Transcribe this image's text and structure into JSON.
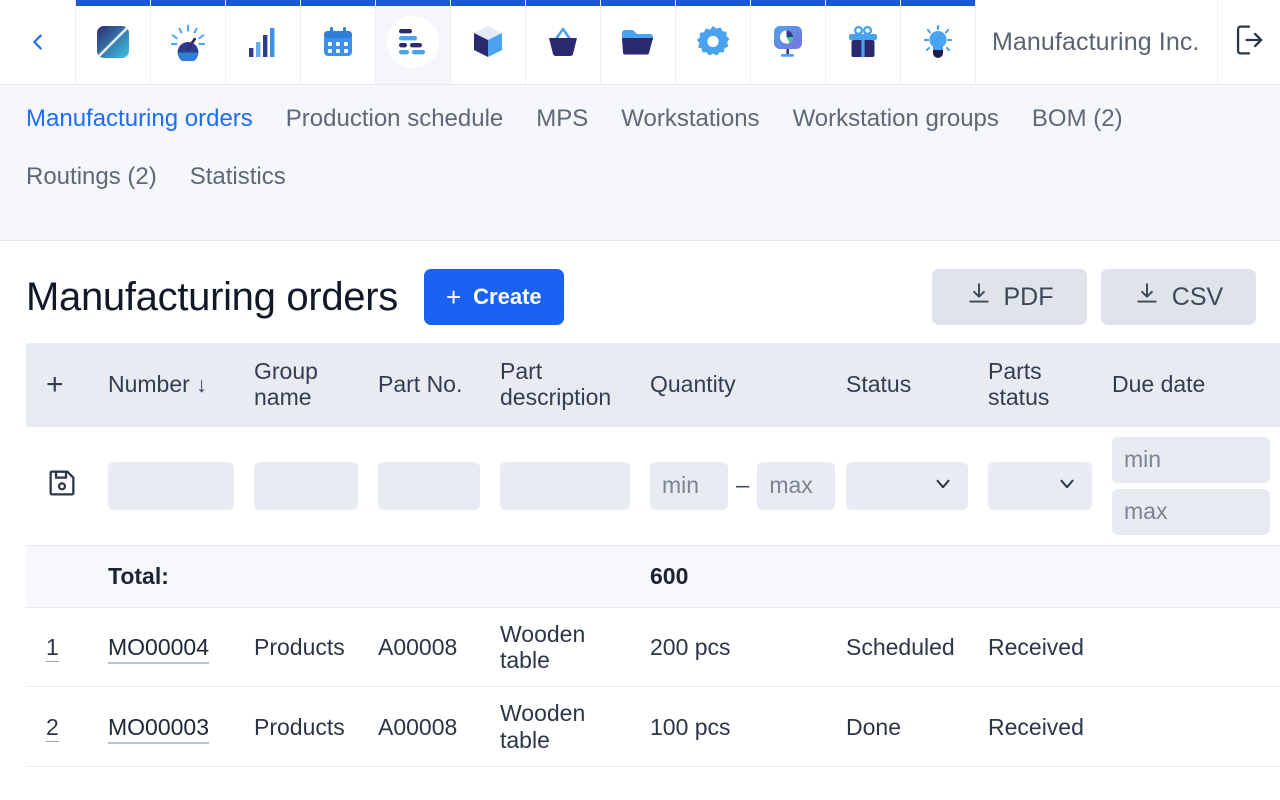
{
  "appbar": {
    "back_icon": "chevron-left-icon",
    "company": "Manufacturing Inc.",
    "logout_icon": "logout-icon",
    "apps": [
      {
        "name": "dashboard-tile-icon",
        "label": "Dashboard"
      },
      {
        "name": "gauge-icon",
        "label": "Overview"
      },
      {
        "name": "bar-chart-icon",
        "label": "Reports"
      },
      {
        "name": "calendar-icon",
        "label": "Calendar"
      },
      {
        "name": "manufacturing-list-icon",
        "label": "Manufacturing",
        "active": true
      },
      {
        "name": "cube-box-icon",
        "label": "Stock"
      },
      {
        "name": "basket-icon",
        "label": "Sales"
      },
      {
        "name": "folder-open-icon",
        "label": "Procurement"
      },
      {
        "name": "gear-icon",
        "label": "Settings"
      },
      {
        "name": "pie-presentation-icon",
        "label": "Analytics"
      },
      {
        "name": "gift-icon",
        "label": "Offers"
      },
      {
        "name": "lightbulb-icon",
        "label": "Tips"
      }
    ]
  },
  "nav": {
    "rows": [
      [
        {
          "label": "Manufacturing orders",
          "active": true
        },
        {
          "label": "Production schedule",
          "active": false
        },
        {
          "label": "MPS",
          "active": false
        },
        {
          "label": "Workstations",
          "active": false
        },
        {
          "label": "Workstation groups",
          "active": false
        },
        {
          "label": "BOM (2)",
          "active": false
        }
      ],
      [
        {
          "label": "Routings (2)",
          "active": false
        },
        {
          "label": "Statistics",
          "active": false
        }
      ]
    ]
  },
  "page": {
    "title": "Manufacturing orders",
    "create_label": "Create",
    "create_plus": "+",
    "pdf_label": "PDF",
    "csv_label": "CSV"
  },
  "table": {
    "add_column_glyph": "+",
    "sort_arrow": "↓",
    "headers": {
      "number": "Number",
      "group_name": "Group name",
      "part_no": "Part No.",
      "part_description": "Part description",
      "quantity": "Quantity",
      "status": "Status",
      "parts_status": "Parts status",
      "due_date": "Due date"
    },
    "filters": {
      "number": "",
      "group_name": "",
      "part_no": "",
      "part_description": "",
      "qty_min_placeholder": "min",
      "qty_max_placeholder": "max",
      "range_dash": "–",
      "status": "",
      "parts_status": "",
      "due_min_placeholder": "min",
      "due_max_placeholder": "max"
    },
    "total": {
      "label": "Total:",
      "quantity": "600"
    },
    "rows": [
      {
        "index": "1",
        "number": "MO00004",
        "group_name": "Products",
        "part_no": "A00008",
        "part_description": "Wooden table",
        "quantity": "200 pcs",
        "status": "Scheduled",
        "parts_status": "Received",
        "due_date": ""
      },
      {
        "index": "2",
        "number": "MO00003",
        "group_name": "Products",
        "part_no": "A00008",
        "part_description": "Wooden table",
        "quantity": "100 pcs",
        "status": "Done",
        "parts_status": "Received",
        "due_date": ""
      }
    ]
  },
  "colors": {
    "accent_blue": "#1a62f2",
    "active_tab": "#1f6dfb",
    "header_bg": "#e8ebf1",
    "nav_bg": "#f5f7fa",
    "text_dark": "#2b3648",
    "text_muted": "#5d6878"
  }
}
